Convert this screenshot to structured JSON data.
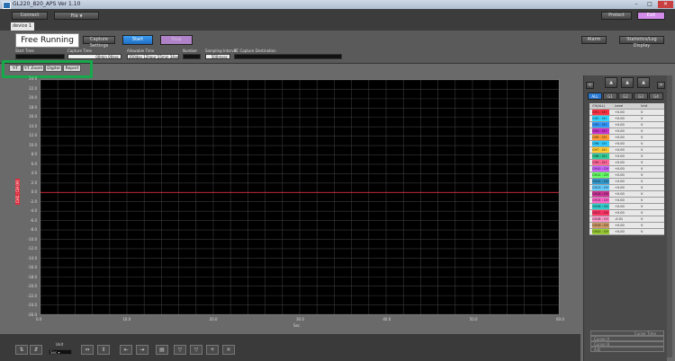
{
  "window": {
    "title": "GL220_820_APS Ver 1.10"
  },
  "menu": {
    "connect": "Connect",
    "file": "File",
    "protect": "Protect",
    "exit": "Exit"
  },
  "tabs": {
    "device": "device 1"
  },
  "control": {
    "mode": "Free Running",
    "capture_settings": "Capture Settings",
    "start": "Start",
    "stop": "Stop",
    "alarm": "Alarm",
    "statistics": "Statistics/Log Display",
    "start_time_label": "Start Time",
    "capture_time_label": "Capture Time",
    "capture_time_value": "00min 00sec",
    "allowable_label": "Allowable Time",
    "allowable_value": "350day 12hour 55min 34sec",
    "number_label": "Number",
    "interval_label": "Sampling Interval",
    "interval_value": "500msec",
    "dest_label": "PC Capture Destination"
  },
  "view_tabs": [
    "Y-T",
    "Y-T Zoom",
    "Digital",
    "Report"
  ],
  "graph": {
    "channel_label": "CH1 : CH (V)",
    "y_ticks": [
      "24.0",
      "22.0",
      "20.0",
      "18.0",
      "16.0",
      "14.0",
      "12.0",
      "10.0",
      "8.0",
      "6.0",
      "4.0",
      "2.0",
      "0.0",
      "-2.0",
      "-4.0",
      "-6.0",
      "-8.0",
      "-10.0",
      "-12.0",
      "-14.0",
      "-16.0",
      "-18.0",
      "-20.0",
      "-22.0",
      "-24.0",
      "-26.0"
    ],
    "x_ticks": [
      "0.0",
      "10.0",
      "20.0",
      "30.0",
      "40.0",
      "50.0",
      "60.0"
    ],
    "x_unit": "Sec"
  },
  "channel_tabs": [
    "ALL",
    "G1",
    "G2",
    "G3",
    "G4"
  ],
  "channel_table": {
    "headers": [
      "CH(ALL)",
      "Level",
      "Unit"
    ],
    "rows": [
      {
        "ch": "CH1 : CH 1",
        "level": "+0.00",
        "unit": "V",
        "color": "#ff3344"
      },
      {
        "ch": "CH2 : CH 2",
        "level": "+0.00",
        "unit": "V",
        "color": "#33d4ff"
      },
      {
        "ch": "CH3 : CH 3",
        "level": "+0.00",
        "unit": "V",
        "color": "#3399ff"
      },
      {
        "ch": "CH4 : CH 4",
        "level": "+0.00",
        "unit": "V",
        "color": "#cc33cc"
      },
      {
        "ch": "CH5 : CH 5",
        "level": "+0.00",
        "unit": "V",
        "color": "#ff9933"
      },
      {
        "ch": "CH6 : CH 6",
        "level": "+0.00",
        "unit": "V",
        "color": "#33ccff"
      },
      {
        "ch": "CH7 : CH 7",
        "level": "+0.00",
        "unit": "V",
        "color": "#ffcc33"
      },
      {
        "ch": "CH8 : CH 8",
        "level": "+0.00",
        "unit": "V",
        "color": "#33cc99"
      },
      {
        "ch": "CH9 : CH 9",
        "level": "+0.00",
        "unit": "V",
        "color": "#ff6699"
      },
      {
        "ch": "CH10 : CH",
        "level": "+0.00",
        "unit": "V",
        "color": "#cc66ff"
      },
      {
        "ch": "CH11 : CH",
        "level": "+0.00",
        "unit": "V",
        "color": "#66ff66"
      },
      {
        "ch": "CH12 : CH",
        "level": "+0.00",
        "unit": "V",
        "color": "#3399cc"
      },
      {
        "ch": "CH13 : CH",
        "level": "+0.00",
        "unit": "V",
        "color": "#66ccff"
      },
      {
        "ch": "CH14 : CH",
        "level": "+0.00",
        "unit": "V",
        "color": "#cc3399"
      },
      {
        "ch": "CH15 : CH",
        "level": "+0.00",
        "unit": "V",
        "color": "#ff66cc"
      },
      {
        "ch": "CH16 : CH",
        "level": "+0.00",
        "unit": "V",
        "color": "#33cccc"
      },
      {
        "ch": "CH17 : CH",
        "level": "+0.00",
        "unit": "V",
        "color": "#ff3366"
      },
      {
        "ch": "CH18 : CH",
        "level": "-0.01",
        "unit": "V",
        "color": "#ff99cc"
      },
      {
        "ch": "CH19 : CH",
        "level": "+0.00",
        "unit": "V",
        "color": "#cc9966"
      },
      {
        "ch": "CH20 : CH",
        "level": "+0.00",
        "unit": "V",
        "color": "#99cc33"
      }
    ]
  },
  "cursor": {
    "title": "Cursor Time",
    "a": "Cursor A",
    "b": "Cursor B",
    "ab": "A-B"
  },
  "bottom": {
    "unit_label": "Unit",
    "unit_value": "Sec"
  }
}
